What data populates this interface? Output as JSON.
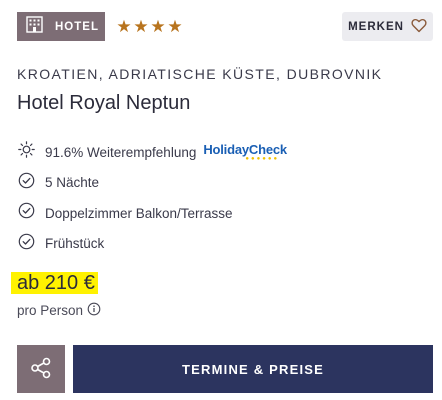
{
  "badge": {
    "label": "HOTEL",
    "icon": "hotel-building-icon"
  },
  "rating": {
    "stars": 4,
    "star_color": "#b8741e"
  },
  "merken": {
    "label": "MERKEN",
    "icon": "heart-outline-icon"
  },
  "location": "KROATIEN, ADRIATISCHE KÜSTE, DUBROVNIK",
  "hotel_name": "Hotel Royal Neptun",
  "features": [
    {
      "icon": "sun-icon",
      "label": "91.6% Weiterempfehlung",
      "logo": "HolidayCheck"
    },
    {
      "icon": "check-circle-icon",
      "label": "5 Nächte"
    },
    {
      "icon": "check-circle-icon",
      "label": "Doppelzimmer Balkon/Terrasse"
    },
    {
      "icon": "check-circle-icon",
      "label": "Frühstück"
    }
  ],
  "price": {
    "text": "ab 210 €",
    "highlight_color": "#fff200"
  },
  "per_person": {
    "label": "pro Person",
    "icon": "info-icon"
  },
  "actions": {
    "share_icon": "share-icon",
    "cta_label": "TERMINE & PREISE"
  },
  "colors": {
    "badge_bg": "#7d6d75",
    "cta_bg": "#2c345f",
    "merken_bg": "#ececf0"
  }
}
